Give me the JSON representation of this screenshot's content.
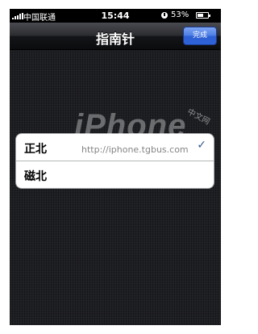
{
  "status_bar": {
    "carrier": "中国联通",
    "time": "15:44",
    "battery_percent": "53%",
    "signal_icon": "signal-bars-icon",
    "alarm_icon": "alarm-clock-icon",
    "battery_icon": "battery-icon"
  },
  "nav": {
    "title": "指南针",
    "done_label": "完成"
  },
  "options": [
    {
      "label": "正北",
      "selected": true
    },
    {
      "label": "磁北",
      "selected": false
    }
  ],
  "check_icon": "✓",
  "watermark": {
    "logo_text": "iPhone",
    "tag": "中文网",
    "url": "http://iphone.tgbus.com"
  },
  "colors": {
    "nav_accent": "#3a6fdc",
    "background": "#1e1f23",
    "checkmark": "#375a91"
  }
}
